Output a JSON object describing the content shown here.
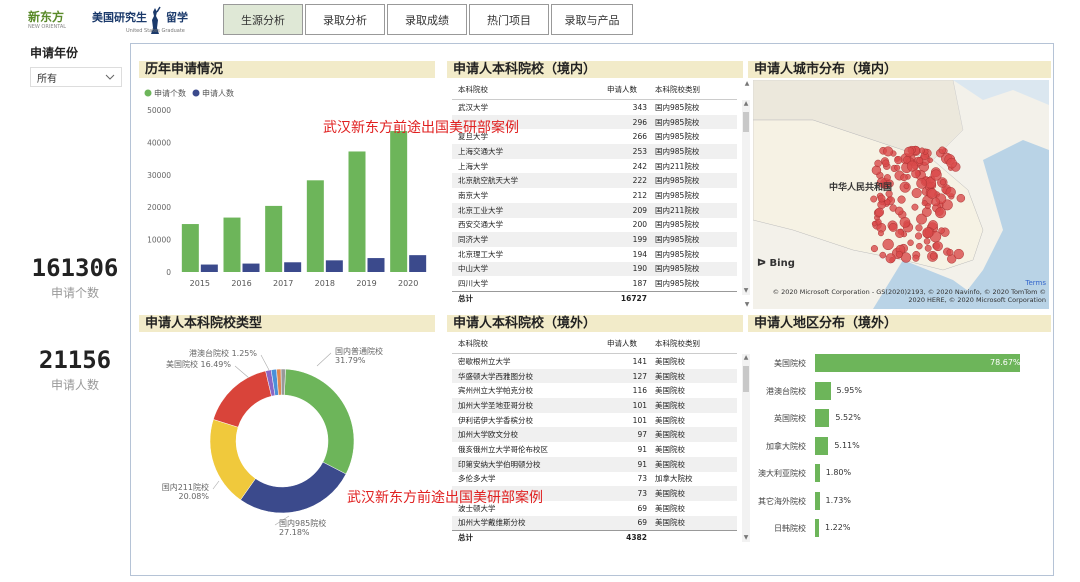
{
  "brand": {
    "logo_text": "新东方",
    "logo_mark": "NEW ORIENTAL",
    "title_main": "美国研究生",
    "title_suffix": "留学",
    "subtitle": "United States Graduate"
  },
  "tabs": [
    {
      "label": "生源分析",
      "active": true
    },
    {
      "label": "录取分析",
      "active": false
    },
    {
      "label": "录取成绩",
      "active": false
    },
    {
      "label": "热门项目",
      "active": false
    },
    {
      "label": "录取与产品",
      "active": false
    }
  ],
  "filter": {
    "label": "申请年份",
    "value": "所有",
    "icon": "chevron-down-icon"
  },
  "kpis": [
    {
      "value": "161306",
      "label": "申请个数"
    },
    {
      "value": "21156",
      "label": "申请人数"
    }
  ],
  "watermark": "武汉新东方前途出国美研部案例",
  "panels": {
    "history": "历年申请情况",
    "domestic_schools": "申请人本科院校（境内）",
    "city_map": "申请人城市分布（境内）",
    "school_type": "申请人本科院校类型",
    "overseas_schools": "申请人本科院校（境外）",
    "overseas_region": "申请人地区分布（境外）"
  },
  "chart_data": [
    {
      "type": "bar",
      "title": "历年申请情况",
      "categories": [
        "2015",
        "2016",
        "2017",
        "2018",
        "2019",
        "2020"
      ],
      "series": [
        {
          "name": "申请个数",
          "color": "#6db55a",
          "values": [
            14800,
            16800,
            20400,
            28300,
            37200,
            43500
          ]
        },
        {
          "name": "申请人数",
          "color": "#3b4a8c",
          "values": [
            2300,
            2600,
            3000,
            3600,
            4300,
            5200
          ]
        }
      ],
      "yticks": [
        "0",
        "10000",
        "20000",
        "30000",
        "40000",
        "50000"
      ],
      "ylim": [
        0,
        50000
      ],
      "legend": "top-left"
    },
    {
      "type": "pie",
      "title": "申请人本科院校类型",
      "slices": [
        {
          "label": "国内普通院校",
          "value": 31.79,
          "text": "31.79%",
          "color": "#6db55a"
        },
        {
          "label": "国内985院校",
          "value": 27.18,
          "text": "27.18%",
          "color": "#3b4a8c"
        },
        {
          "label": "国内211院校",
          "value": 20.08,
          "text": "20.08%",
          "color": "#f0c93c"
        },
        {
          "label": "美国院校",
          "value": 16.49,
          "text": "16.49%",
          "color": "#d9443a"
        },
        {
          "label": "港澳台院校",
          "value": 1.25,
          "text": "1.25%",
          "color": "#8b66c4"
        },
        {
          "label": "",
          "value": 1.2,
          "text": "",
          "color": "#4a90d9"
        },
        {
          "label": "",
          "value": 1.0,
          "text": "",
          "color": "#e08850"
        },
        {
          "label": "",
          "value": 1.01,
          "text": "",
          "color": "#999999"
        }
      ]
    },
    {
      "type": "bar",
      "title": "申请人地区分布（境外）",
      "orientation": "horizontal",
      "categories": [
        "美国院校",
        "港澳台院校",
        "英国院校",
        "加拿大院校",
        "澳大利亚院校",
        "其它海外院校",
        "日韩院校"
      ],
      "values": [
        78.67,
        5.95,
        5.52,
        5.11,
        1.8,
        1.73,
        1.22
      ],
      "labels": [
        "78.67%",
        "5.95%",
        "5.52%",
        "5.11%",
        "1.80%",
        "1.73%",
        "1.22%"
      ],
      "xlim": [
        0,
        78.67
      ]
    },
    {
      "type": "scatter",
      "title": "申请人城市分布（境内）",
      "map_label": "中华人民共和国",
      "bing": "Bing",
      "terms": "Terms",
      "copyright": "© 2020 Microsoft Corporation - GS(2020)2193, © 2020 Navinfo, © 2020 TomTom ©",
      "copyright2": "2020 HERE, © 2020 Microsoft Corporation"
    }
  ],
  "domestic_table": {
    "headers": [
      "本科院校",
      "申请人数",
      "本科院校类别"
    ],
    "rows": [
      [
        "武汉大学",
        "343",
        "国内985院校"
      ],
      [
        "",
        "296",
        "国内985院校"
      ],
      [
        "复旦大学",
        "266",
        "国内985院校"
      ],
      [
        "上海交通大学",
        "253",
        "国内985院校"
      ],
      [
        "上海大学",
        "242",
        "国内211院校"
      ],
      [
        "北京航空航天大学",
        "222",
        "国内985院校"
      ],
      [
        "南京大学",
        "212",
        "国内985院校"
      ],
      [
        "北京工业大学",
        "209",
        "国内211院校"
      ],
      [
        "西安交通大学",
        "200",
        "国内985院校"
      ],
      [
        "同济大学",
        "199",
        "国内985院校"
      ],
      [
        "北京理工大学",
        "194",
        "国内985院校"
      ],
      [
        "中山大学",
        "190",
        "国内985院校"
      ],
      [
        "四川大学",
        "187",
        "国内985院校"
      ]
    ],
    "total_label": "总计",
    "total": "16727"
  },
  "overseas_table": {
    "headers": [
      "本科院校",
      "申请人数",
      "本科院校类别"
    ],
    "rows": [
      [
        "密歇根州立大学",
        "141",
        "美国院校"
      ],
      [
        "华盛顿大学西雅图分校",
        "127",
        "美国院校"
      ],
      [
        "宾州州立大学帕克分校",
        "116",
        "美国院校"
      ],
      [
        "加州大学圣地亚哥分校",
        "101",
        "美国院校"
      ],
      [
        "伊利诺伊大学香槟分校",
        "101",
        "美国院校"
      ],
      [
        "加州大学欧文分校",
        "97",
        "美国院校"
      ],
      [
        "俄亥俄州立大学哥伦布校区",
        "91",
        "美国院校"
      ],
      [
        "印第安纳大学伯明顿分校",
        "91",
        "美国院校"
      ],
      [
        "多伦多大学",
        "73",
        "加拿大院校"
      ],
      [
        "",
        "73",
        "美国院校"
      ],
      [
        "波士顿大学",
        "69",
        "美国院校"
      ],
      [
        "加州大学戴维斯分校",
        "69",
        "美国院校"
      ]
    ],
    "total_label": "总计",
    "total": "4382"
  }
}
